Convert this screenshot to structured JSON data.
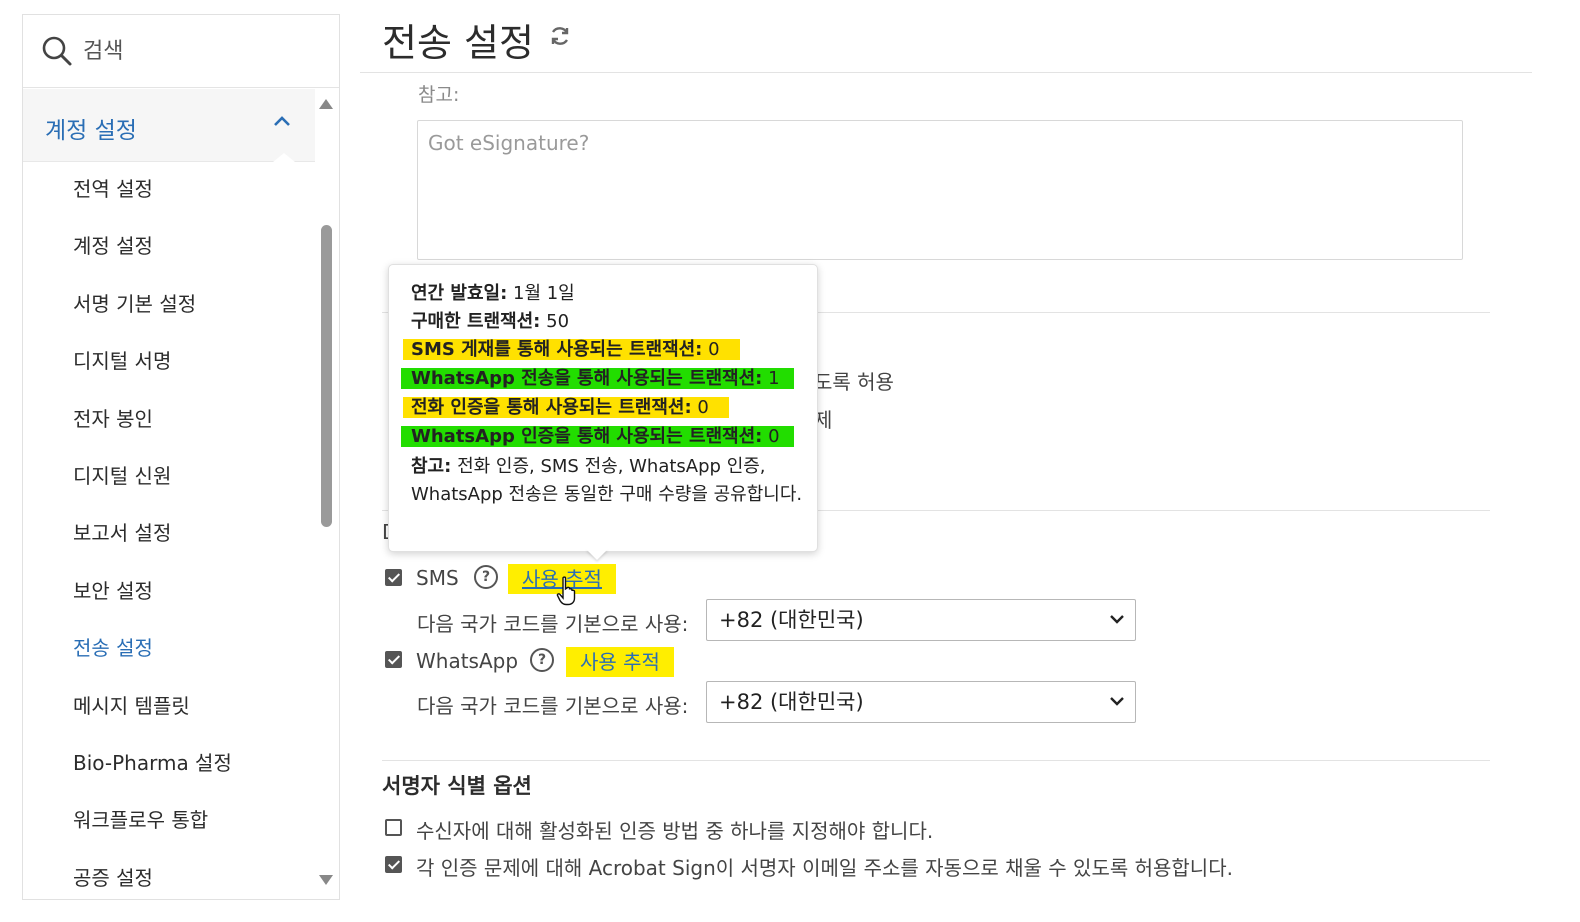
{
  "sidebar": {
    "search_placeholder": "검색",
    "section_title": "계정 설정",
    "items": [
      {
        "label": "전역 설정"
      },
      {
        "label": "계정 설정"
      },
      {
        "label": "서명 기본 설정"
      },
      {
        "label": "디지털 서명"
      },
      {
        "label": "전자 봉인"
      },
      {
        "label": "디지털 신원"
      },
      {
        "label": "보고서 설정"
      },
      {
        "label": "보안 설정"
      },
      {
        "label": "전송 설정",
        "active": true
      },
      {
        "label": "메시지 템플릿"
      },
      {
        "label": "Bio-Pharma 설정"
      },
      {
        "label": "워크플로우 통합"
      },
      {
        "label": "공증 설정"
      }
    ]
  },
  "main": {
    "title": "전송 설정",
    "note_label": "참고:",
    "note_placeholder": "Got eSignature?",
    "partial_text_1": "도록 허용",
    "partial_text_2": "제",
    "partial_text_3": "D",
    "sms": {
      "label": "SMS",
      "track_label": "사용 추적",
      "country_label": "다음 국가 코드를 기본으로 사용:",
      "country_value": "+82 (대한민국)"
    },
    "whatsapp": {
      "label": "WhatsApp",
      "track_label": "사용 추적",
      "country_label": "다음 국가 코드를 기본으로 사용:",
      "country_value": "+82 (대한민국)"
    },
    "signer_section_title": "서명자 식별 옵션",
    "signer_options": [
      {
        "label": "수신자에 대해 활성화된 인증 방법 중 하나를 지정해야 합니다.",
        "checked": false
      },
      {
        "label": "각 인증 문제에 대해 Acrobat Sign이 서명자 이메일 주소를 자동으로 채울 수 있도록 허용합니다.",
        "checked": true
      }
    ]
  },
  "tooltip": {
    "annual_key": "연간 발효일:",
    "annual_val": "1월 1일",
    "purchased_key": "구매한 트랜잭션:",
    "purchased_val": "50",
    "sms_key": "SMS 게재를 통해 사용되는 트랜잭션:",
    "sms_val": "0",
    "wa_delivery_key": "WhatsApp 전송을 통해 사용되는 트랜잭션:",
    "wa_delivery_val": "1",
    "phone_key": "전화 인증을 통해 사용되는 트랜잭션:",
    "phone_val": "0",
    "wa_auth_key": "WhatsApp 인증을 통해 사용되는 트랜잭션:",
    "wa_auth_val": "0",
    "note_key": "참고:",
    "note_text": "전화 인증, SMS 전송, WhatsApp 인증, WhatsApp 전송은 동일한 구매 수량을 공유합니다."
  },
  "colors": {
    "accent": "#2a6eb5",
    "highlight_yellow": "#ffe100",
    "highlight_green": "#22dd00"
  }
}
